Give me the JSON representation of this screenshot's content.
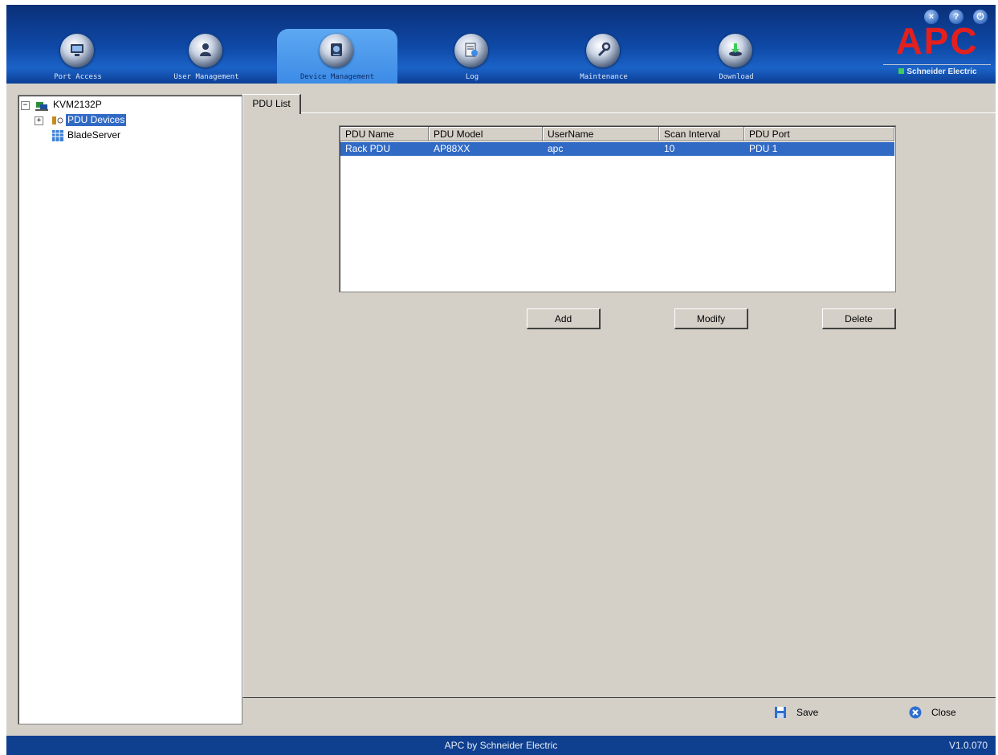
{
  "nav": {
    "tabs": [
      {
        "label": "Port Access",
        "icon": "port-access-icon"
      },
      {
        "label": "User Management",
        "icon": "user-management-icon"
      },
      {
        "label": "Device Management",
        "icon": "device-management-icon",
        "active": true
      },
      {
        "label": "Log",
        "icon": "log-icon"
      },
      {
        "label": "Maintenance",
        "icon": "maintenance-icon"
      },
      {
        "label": "Download",
        "icon": "download-icon"
      }
    ],
    "window_buttons": {
      "close": "×",
      "help": "?",
      "logout": "⏻"
    }
  },
  "brand": {
    "logo_text": "APC",
    "company": "Schneider Electric"
  },
  "tree": {
    "root": {
      "label": "KVM2132P",
      "expander": "−"
    },
    "items": [
      {
        "label": "PDU Devices",
        "expander": "+",
        "selected": true
      },
      {
        "label": "BladeServer"
      }
    ]
  },
  "tab": {
    "label": "PDU List"
  },
  "list": {
    "columns": [
      "PDU Name",
      "PDU Model",
      "UserName",
      "Scan Interval",
      "PDU Port"
    ],
    "rows": [
      [
        "Rack PDU",
        "AP88XX",
        "apc",
        "10",
        "PDU 1"
      ]
    ]
  },
  "actions": {
    "add": "Add",
    "modify": "Modify",
    "delete": "Delete"
  },
  "footer_actions": {
    "save": "Save",
    "close": "Close"
  },
  "status": {
    "center": "APC by Schneider Electric",
    "version": "V1.0.070"
  },
  "colors": {
    "brand_red": "#e4201f",
    "nav_blue": "#0f4aa8",
    "selection": "#316ac5"
  }
}
